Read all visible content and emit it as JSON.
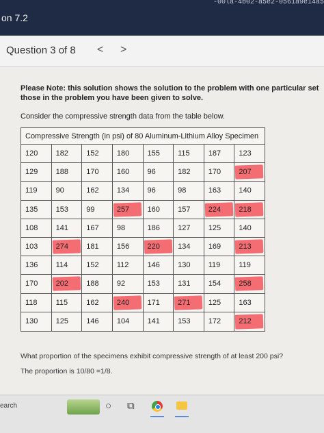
{
  "window": {
    "title": "on 7.2",
    "url_fragment": "-00la-4b02-a5e2-0561a9e14a5"
  },
  "question_bar": {
    "title": "Question 3 of 8",
    "prev": "<",
    "next": ">"
  },
  "content": {
    "note_line1": "Please Note: this solution shows the solution to the problem with one particular set of v",
    "note_line2": "those in the problem you have been given to solve.",
    "consider": "Consider the compressive strength data from the table below.",
    "table_caption": "Compressive Strength (in psi) of 80 Aluminum-Lithium Alloy Specimen",
    "rows": [
      [
        "120",
        "182",
        "152",
        "180",
        "155",
        "115",
        "187",
        "123"
      ],
      [
        "129",
        "188",
        "170",
        "160",
        "96",
        "182",
        "170",
        "207"
      ],
      [
        "119",
        "90",
        "162",
        "134",
        "96",
        "98",
        "163",
        "140"
      ],
      [
        "135",
        "153",
        "99",
        "257",
        "160",
        "157",
        "224",
        "218"
      ],
      [
        "108",
        "141",
        "167",
        "98",
        "186",
        "127",
        "125",
        "140"
      ],
      [
        "103",
        "274",
        "181",
        "156",
        "220",
        "134",
        "169",
        "213"
      ],
      [
        "136",
        "114",
        "152",
        "112",
        "146",
        "130",
        "119",
        "119"
      ],
      [
        "170",
        "202",
        "188",
        "92",
        "153",
        "131",
        "154",
        "258"
      ],
      [
        "118",
        "115",
        "162",
        "240",
        "171",
        "271",
        "125",
        "163"
      ],
      [
        "130",
        "125",
        "146",
        "104",
        "141",
        "153",
        "172",
        "212"
      ]
    ],
    "highlight_color": "#f44650",
    "question": "What proportion of the specimens exhibit compressive strength of at least 200 psi?",
    "answer": "The proportion is 10/80 =1/8."
  },
  "taskbar": {
    "search": "earch"
  }
}
